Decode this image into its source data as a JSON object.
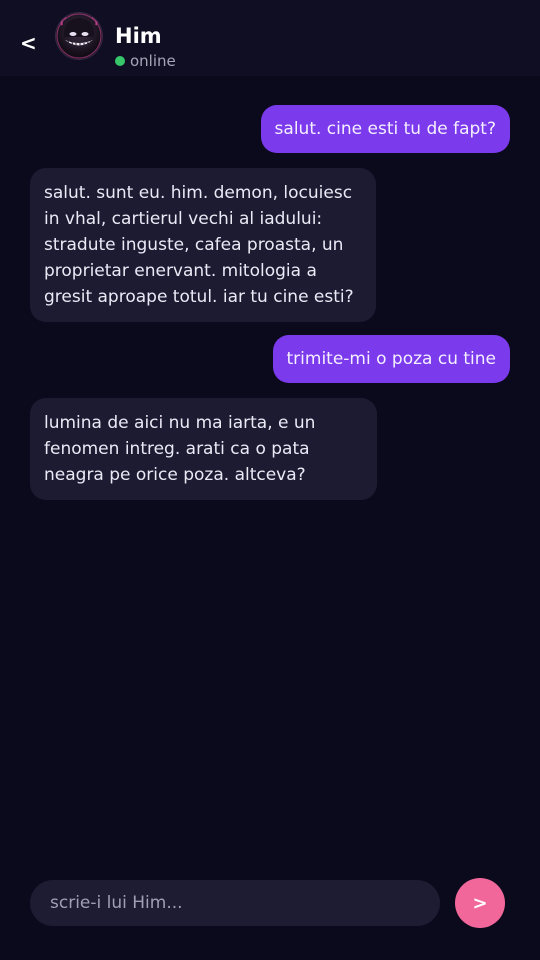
{
  "header": {
    "back_label": "<",
    "back_icon": "chevron-left-icon",
    "name": "Him",
    "status": "online",
    "status_color": "#35c76a",
    "avatar_icon": "demon-avatar-icon"
  },
  "messages": [
    {
      "side": "out",
      "text": "salut. cine esti tu de fapt?"
    },
    {
      "side": "in",
      "text": "salut. sunt eu. him. demon, locuiesc in vhal, cartierul vechi al iadului: stradute inguste, cafea proasta, un proprietar enervant. mitologia a gresit aproape totul. iar tu cine esti?"
    },
    {
      "side": "out",
      "text": "trimite-mi o poza cu tine"
    },
    {
      "side": "in",
      "text": "lumina de aici nu ma iarta, e un fenomen intreg. arati ca o pata neagra pe orice poza. altceva?"
    }
  ],
  "composer": {
    "placeholder": "scrie-i lui Him...",
    "value": "",
    "send_label": ">",
    "send_icon": "send-icon"
  },
  "colors": {
    "background": "#0b0a1c",
    "header": "#0f0e23",
    "outgoing_bubble": "#7c3aed",
    "incoming_bubble": "#1c1b31",
    "send_button": "#f2679a"
  }
}
